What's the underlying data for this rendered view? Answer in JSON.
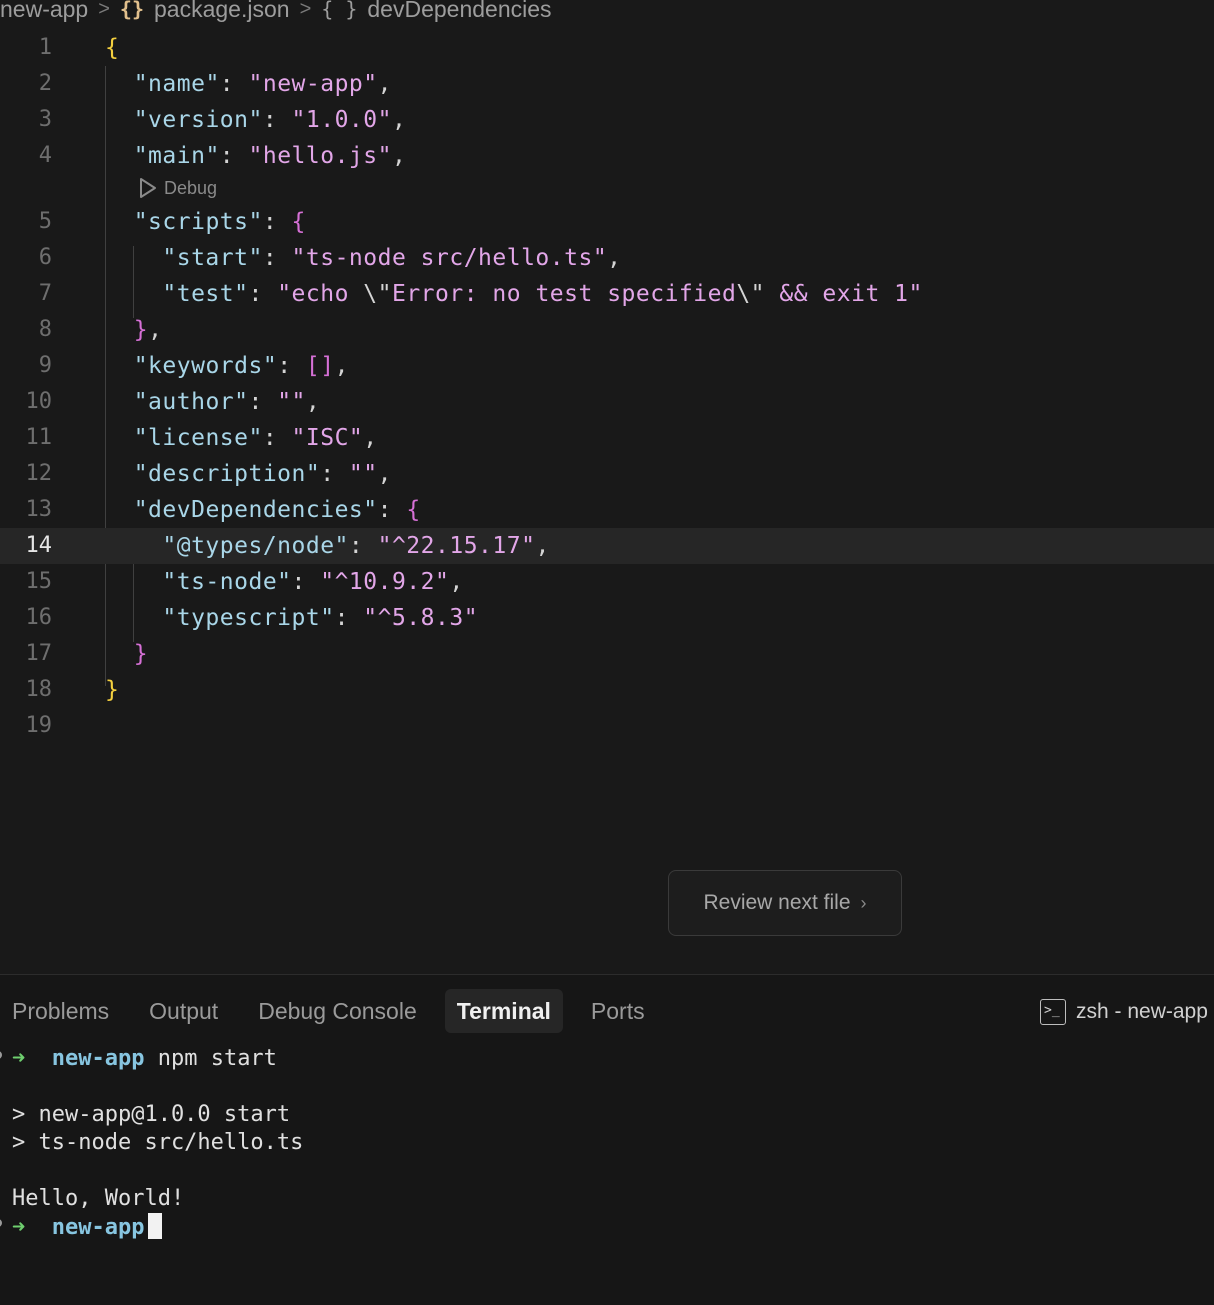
{
  "breadcrumb": {
    "folder": "new-app",
    "file": "package.json",
    "symbol": "devDependencies",
    "file_icon": "{}",
    "symbol_icon": "{ }"
  },
  "editor": {
    "line_numbers": [
      "1",
      "2",
      "3",
      "4",
      "5",
      "6",
      "7",
      "8",
      "9",
      "10",
      "11",
      "12",
      "13",
      "14",
      "15",
      "16",
      "17",
      "18",
      "19"
    ],
    "current_line": "14",
    "codelens_label": "Debug"
  },
  "review_button": {
    "label": "Review next file",
    "chevron": "›"
  },
  "panel": {
    "tabs": [
      {
        "label": "Problems"
      },
      {
        "label": "Output"
      },
      {
        "label": "Debug Console"
      },
      {
        "label": "Terminal"
      },
      {
        "label": "Ports"
      }
    ],
    "active_tab": "Terminal",
    "terminal_name": "zsh - new-app"
  },
  "terminal": {
    "prompt_arrow": "➜",
    "prompt_dir": "new-app",
    "command": "npm start",
    "out1": "> new-app@1.0.0 start",
    "out2": "> ts-node src/hello.ts",
    "out3": "Hello, World!"
  }
}
